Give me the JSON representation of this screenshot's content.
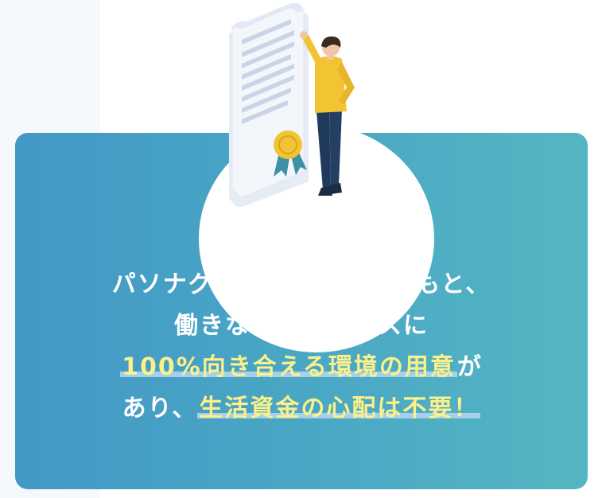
{
  "message": {
    "line1": "パソナグループ全面協力のもと、",
    "line2": "働きながらビジネスに",
    "line3_highlight": "100%向き合える環境の用意",
    "line3_suffix": "が",
    "line4_prefix": "あり、",
    "line4_highlight": "生活資金の心配は不要！"
  },
  "colors": {
    "card_gradient_start": "#4398c6",
    "card_gradient_end": "#55b6c2",
    "highlight_text": "#fbf08a",
    "highlight_marker": "#aad2ec",
    "shirt": "#f2c332",
    "pants": "#1f3a5c",
    "seal": "#f2c332",
    "ribbon": "#3f8fa6"
  },
  "illustration": {
    "icon": "certificate-with-businessman-icon"
  }
}
